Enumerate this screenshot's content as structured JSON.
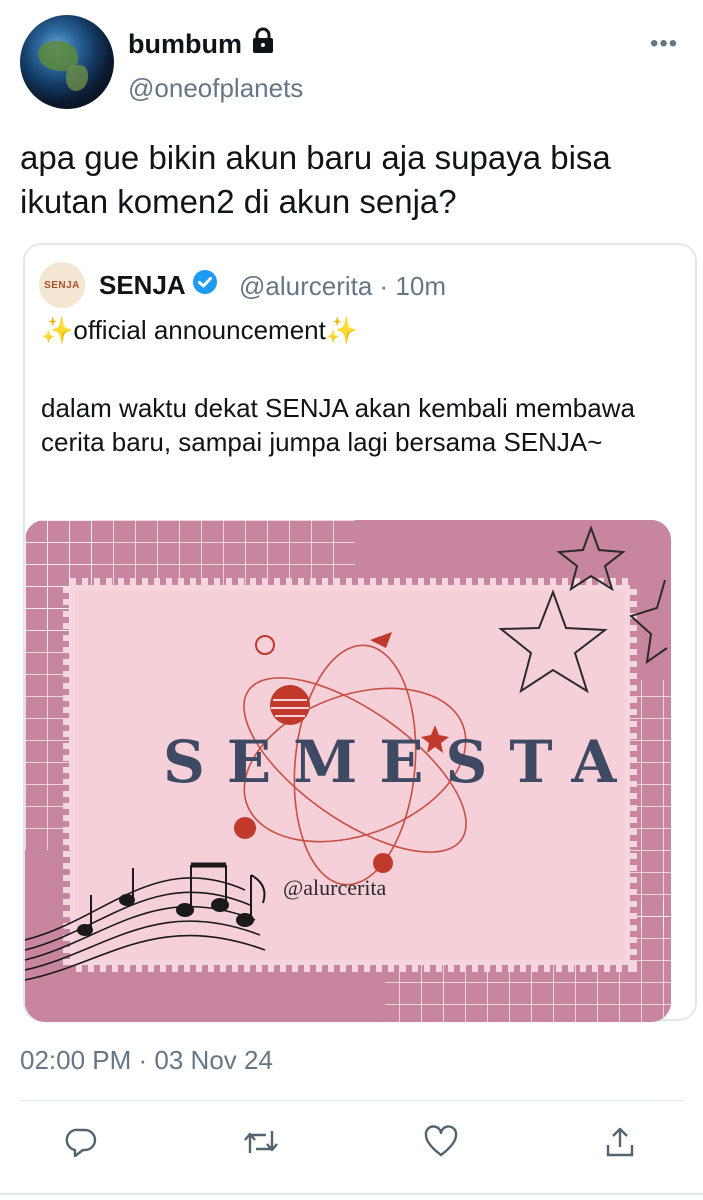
{
  "author": {
    "display_name": "bumbum",
    "handle": "@oneofplanets",
    "lock_icon": "lock-icon"
  },
  "more_label": "•••",
  "tweet_text": "apa gue bikin akun baru aja supaya bisa ikutan komen2 di akun senja?",
  "quote": {
    "avatar_text": "SENJA",
    "name": "SENJA",
    "handle_time": "@alurcerita · 10m",
    "line1": "✨official announcement✨",
    "body": "dalam waktu dekat SENJA akan kembali membawa cerita baru, sampai jumpa lagi bersama SENJA~",
    "image": {
      "title": "SEMESTA",
      "credit": "@alurcerita"
    }
  },
  "timestamp": "02:00 PM · 03 Nov 24",
  "actions": [
    "reply-icon",
    "retweet-icon",
    "like-icon",
    "share-icon"
  ],
  "colors": {
    "secondary_text": "#657786",
    "image_bg": "#c8859f",
    "image_panel": "#f6d3da",
    "title_color": "#3e4a63",
    "verified": "#1d9bf0"
  }
}
